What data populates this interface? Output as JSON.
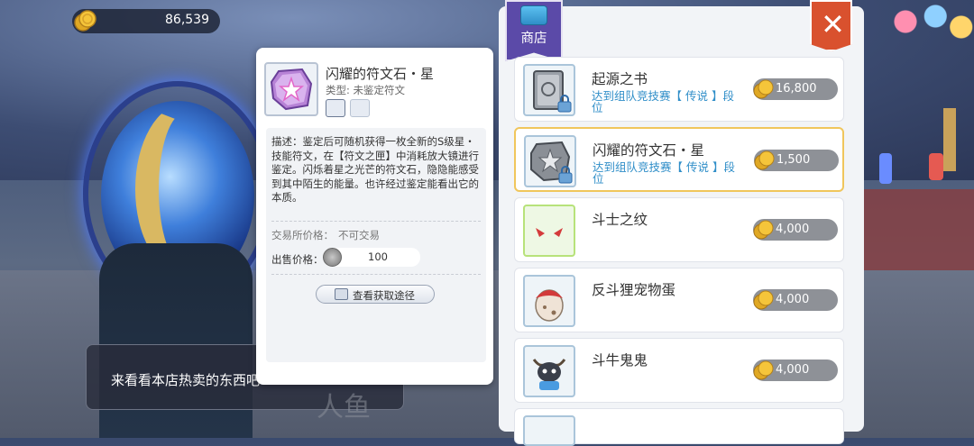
{
  "currency": {
    "amount": "86,539"
  },
  "dialog": {
    "text": "来看看本店热卖的东西吧",
    "npc_name": "人鱼"
  },
  "item_detail": {
    "title": "闪耀的符文石・星",
    "type_label": "类型:",
    "type_value": "未鉴定符文",
    "description": "描述：鉴定后可随机获得一枚全新的S级星・技能符文，在【符文之匣】中消耗放大镜进行鉴定。闪烁着星之光芒的符文石，隐隐能感受到其中陌生的能量。也许经过鉴定能看出它的本质。",
    "trade_price_label": "交易所价格：",
    "trade_price_value": "不可交易",
    "sell_price_label": "出售价格：",
    "sell_price_value": "100",
    "source_button": "查看获取途径"
  },
  "shop": {
    "title": "商店",
    "close_label": "✕",
    "items": [
      {
        "name": "起源之书",
        "condition": "达到组队竞技赛【 传说 】段位",
        "price": "16,800",
        "locked": true,
        "icon": "book-icon"
      },
      {
        "name": "闪耀的符文石・星",
        "condition": "达到组队竞技赛【 传说 】段位",
        "price": "1,500",
        "locked": true,
        "selected": true,
        "icon": "rune-stone-icon"
      },
      {
        "name": "斗士之纹",
        "condition": "",
        "price": "4,000",
        "locked": false,
        "icon": "fighter-pattern-icon"
      },
      {
        "name": "反斗狸宠物蛋",
        "condition": "",
        "price": "4,000",
        "locked": false,
        "icon": "pet-egg-icon"
      },
      {
        "name": "斗牛鬼鬼",
        "condition": "",
        "price": "4,000",
        "locked": false,
        "icon": "bull-ghost-icon"
      }
    ]
  }
}
